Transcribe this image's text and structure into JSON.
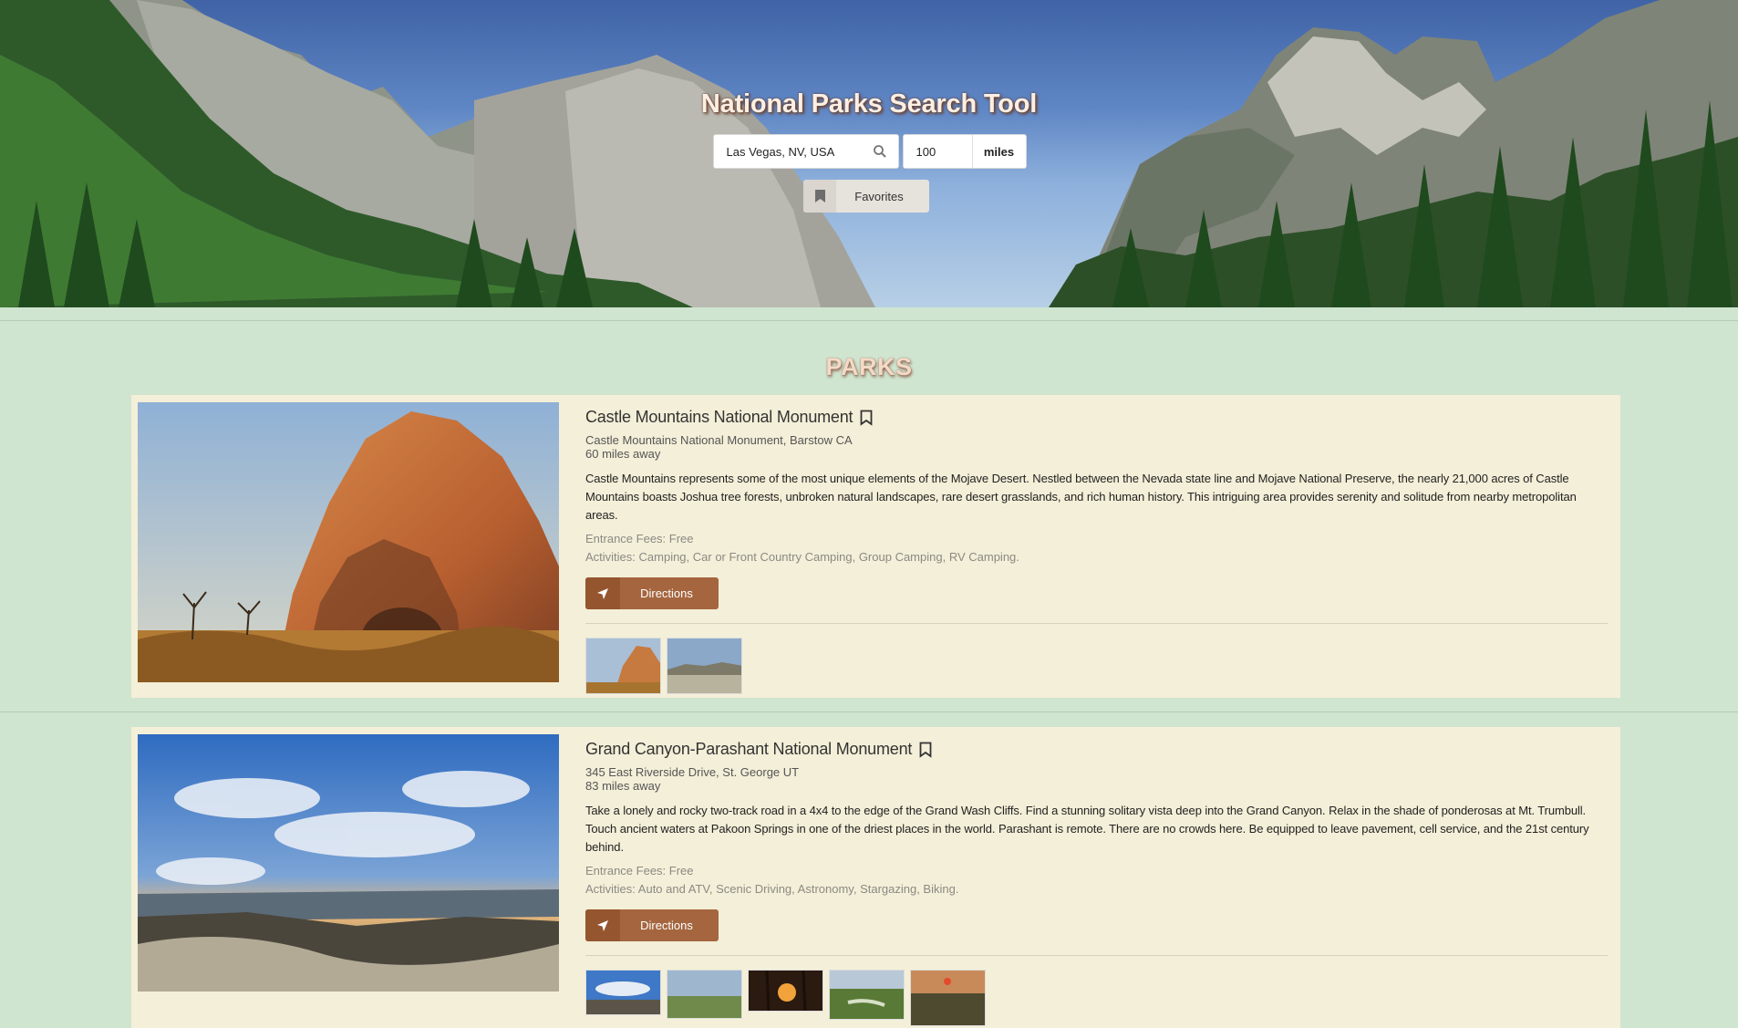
{
  "hero": {
    "title": "National Parks Search Tool",
    "search_value": "Las Vegas, NV, USA",
    "distance_value": "100",
    "distance_unit": "miles",
    "favorites_label": "Favorites"
  },
  "parks_heading": "PARKS",
  "parks": [
    {
      "name": "Castle Mountains National Monument",
      "address": "Castle Mountains National Monument, Barstow CA",
      "distance": "60 miles away",
      "description": "Castle Mountains represents some of the most unique elements of the Mojave Desert. Nestled between the Nevada state line and Mojave National Preserve, the nearly 21,000 acres of Castle Mountains boasts Joshua tree forests, unbroken natural landscapes, rare desert grasslands, and rich human history. This intriguing area provides serenity and solitude from nearby metropolitan areas.",
      "fees": "Entrance Fees: Free",
      "activities": "Activities: Camping, Car or Front Country Camping, Group Camping, RV Camping.",
      "directions_label": "Directions",
      "thumbnail_count": 2
    },
    {
      "name": "Grand Canyon-Parashant National Monument",
      "address": "345 East Riverside Drive, St. George UT",
      "distance": "83 miles away",
      "description": "Take a lonely and rocky two-track road in a 4x4 to the edge of the Grand Wash Cliffs. Find a stunning solitary vista deep into the Grand Canyon. Relax in the shade of ponderosas at Mt. Trumbull. Touch ancient waters at Pakoon Springs in one of the driest places in the world. Parashant is remote. There are no crowds here. Be equipped to leave pavement, cell service, and the 21st century behind.",
      "fees": "Entrance Fees: Free",
      "activities": "Activities: Auto and ATV, Scenic Driving, Astronomy, Stargazing, Biking.",
      "directions_label": "Directions",
      "thumbnail_count": 5
    }
  ],
  "icons": {
    "search": "magnifier-icon",
    "bookmark": "bookmark-icon",
    "directions": "location-arrow-icon"
  },
  "colors": {
    "page_bg": "#cfe5d0",
    "card_bg": "#f4efd8",
    "directions_btn": "#a5663f",
    "title_text": "#fbefe4"
  }
}
